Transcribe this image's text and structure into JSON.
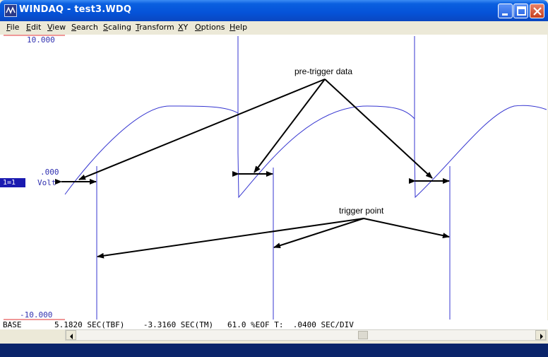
{
  "window": {
    "title": "WINDAQ - test3.WDQ"
  },
  "menu": [
    {
      "key": "F",
      "rest": "ile"
    },
    {
      "key": "E",
      "rest": "dit"
    },
    {
      "key": "V",
      "rest": "iew"
    },
    {
      "key": "S",
      "rest": "earch"
    },
    {
      "key": "S",
      "rest": "caling"
    },
    {
      "key": "T",
      "rest": "ransform"
    },
    {
      "key": "X",
      "rest": "Y"
    },
    {
      "key": "O",
      "rest": "ptions"
    },
    {
      "key": "H",
      "rest": "elp"
    }
  ],
  "plot": {
    "y_top": "10.000",
    "y_zero": ".000",
    "y_bottom": "-10.000",
    "unit": "Volt",
    "channel": "1=1",
    "trace_color": "#3535d0"
  },
  "annotations": {
    "pre_trigger": "pre-trigger data",
    "trigger_point": "trigger point"
  },
  "status": {
    "base": "BASE",
    "line": "5.1820 SEC(TBF)    -3.3160 SEC(TM)   61.0 %EOF T:  .0400 SEC/DIV"
  }
}
